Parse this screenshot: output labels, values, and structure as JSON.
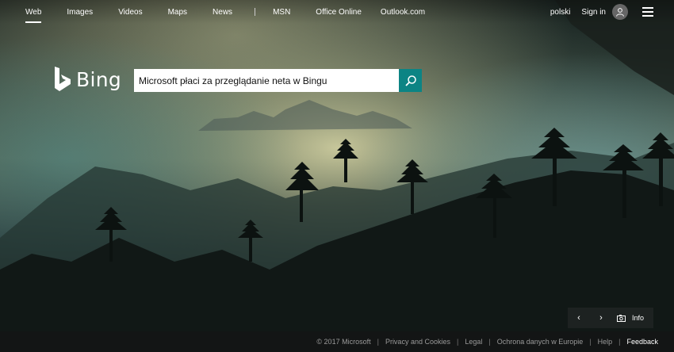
{
  "nav": {
    "left": [
      "Web",
      "Images",
      "Videos",
      "Maps",
      "News"
    ],
    "right_links": [
      "MSN",
      "Office Online",
      "Outlook.com"
    ],
    "language": "polski",
    "signin": "Sign in"
  },
  "logo": {
    "text": "Bing"
  },
  "search": {
    "value": "Microsoft płaci za przeglądanie neta w Bingu"
  },
  "carousel": {
    "info_label": "Info"
  },
  "footer": {
    "copyright": "© 2017 Microsoft",
    "privacy": "Privacy and Cookies",
    "legal": "Legal",
    "data_protection": "Ochrona danych w Europie",
    "help": "Help",
    "feedback": "Feedback"
  },
  "icons": {
    "search": "search-icon",
    "user": "user-icon",
    "menu": "hamburger-icon",
    "prev": "chevron-left-icon",
    "next": "chevron-right-icon",
    "camera": "camera-icon",
    "logo": "bing-logo-icon"
  }
}
